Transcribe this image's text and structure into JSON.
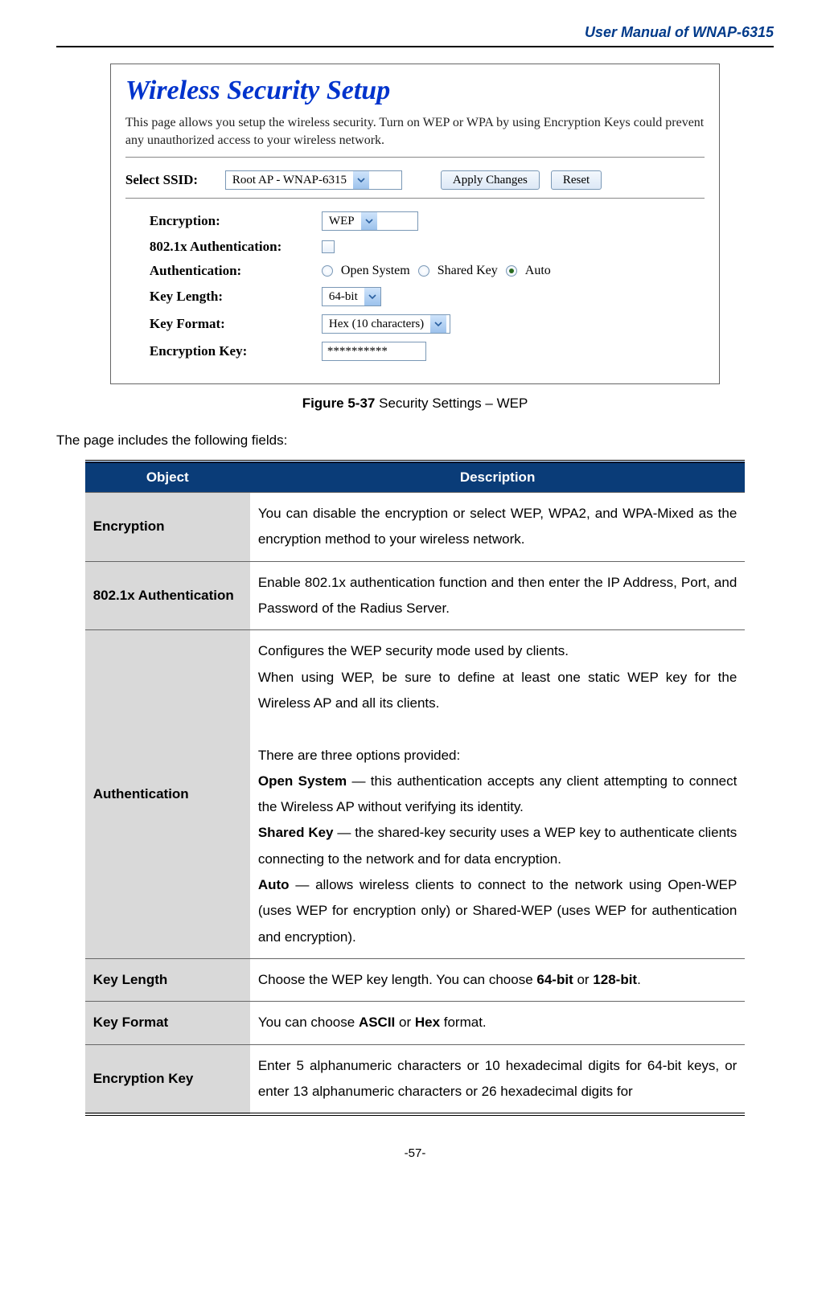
{
  "header": {
    "title": "User Manual of WNAP-6315"
  },
  "screenshot": {
    "title": "Wireless Security Setup",
    "description": "This page allows you setup the wireless security. Turn on WEP or WPA by using Encryption Keys could prevent any unauthorized access to your wireless network.",
    "ssid": {
      "label": "Select SSID:",
      "value": "Root AP - WNAP-6315",
      "apply_btn": "Apply Changes",
      "reset_btn": "Reset"
    },
    "rows": {
      "encryption": {
        "label": "Encryption:",
        "value": "WEP"
      },
      "dot1x": {
        "label": "802.1x Authentication:"
      },
      "auth": {
        "label": "Authentication:",
        "opt1": "Open System",
        "opt2": "Shared Key",
        "opt3": "Auto"
      },
      "keylen": {
        "label": "Key Length:",
        "value": "64-bit"
      },
      "keyfmt": {
        "label": "Key Format:",
        "value": "Hex (10 characters)"
      },
      "enckey": {
        "label": "Encryption Key:",
        "value": "**********"
      }
    }
  },
  "caption": {
    "bold": "Figure 5-37",
    "rest": " Security Settings – WEP"
  },
  "intro": "The page includes the following fields:",
  "table": {
    "head_object": "Object",
    "head_description": "Description",
    "rows": [
      {
        "object": "Encryption",
        "desc_html": "You can disable the encryption or select WEP, WPA2, and WPA-Mixed as the encryption method to your wireless network."
      },
      {
        "object": "802.1x Authentication",
        "desc_html": "Enable 802.1x authentication function and then enter the IP Address, Port, and Password of the Radius Server."
      },
      {
        "object": "Authentication",
        "desc_html": "Configures the WEP security mode used by clients.<br>When using WEP, be sure to define at least one static WEP key for the Wireless AP and all its clients.<br><br>There are three options provided:<br><b>Open System</b> — this authentication accepts any client attempting to connect the Wireless AP without verifying its identity.<br><b>Shared Key</b> — the shared-key security uses a WEP key to authenticate clients connecting to the network and for data encryption.<br><b>Auto</b> — allows wireless clients to connect to the network using Open-WEP (uses WEP for encryption only) or Shared-WEP (uses WEP for authentication and encryption)."
      },
      {
        "object": "Key Length",
        "desc_html": "Choose the WEP key length. You can choose <b>64-bit</b> or <b>128-bit</b>."
      },
      {
        "object": "Key Format",
        "desc_html": "You can choose <b>ASCII</b> or <b>Hex</b> format."
      },
      {
        "object": "Encryption Key",
        "desc_html": "Enter 5 alphanumeric characters or 10 hexadecimal digits for 64-bit keys, or enter 13 alphanumeric characters or 26 hexadecimal digits for"
      }
    ]
  },
  "page_number": "-57-"
}
